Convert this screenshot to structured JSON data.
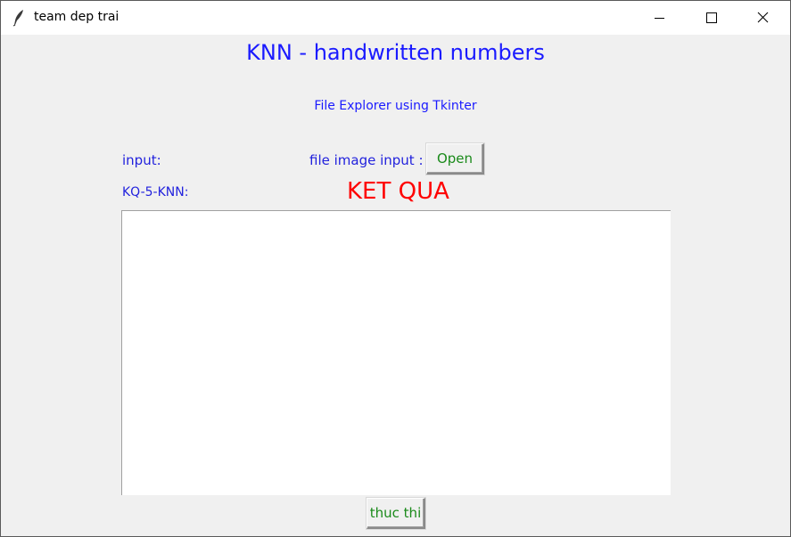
{
  "window": {
    "title": "team dep trai"
  },
  "main": {
    "heading": "KNN - handwritten numbers",
    "subheading": "File Explorer using Tkinter",
    "input_label": "input:",
    "file_label": "file image input :",
    "open_button": "Open",
    "kq_label": "KQ-5-KNN:",
    "result_title": "KET QUA",
    "result_text": "",
    "run_button": "thuc thi"
  },
  "colors": {
    "heading": "#1a1aff",
    "label": "#2222dd",
    "button_text": "#1a8a1a",
    "result_title": "#ff0000"
  },
  "icons": {
    "app": "feather-icon",
    "minimize": "minimize-icon",
    "maximize": "maximize-icon",
    "close": "close-icon"
  }
}
